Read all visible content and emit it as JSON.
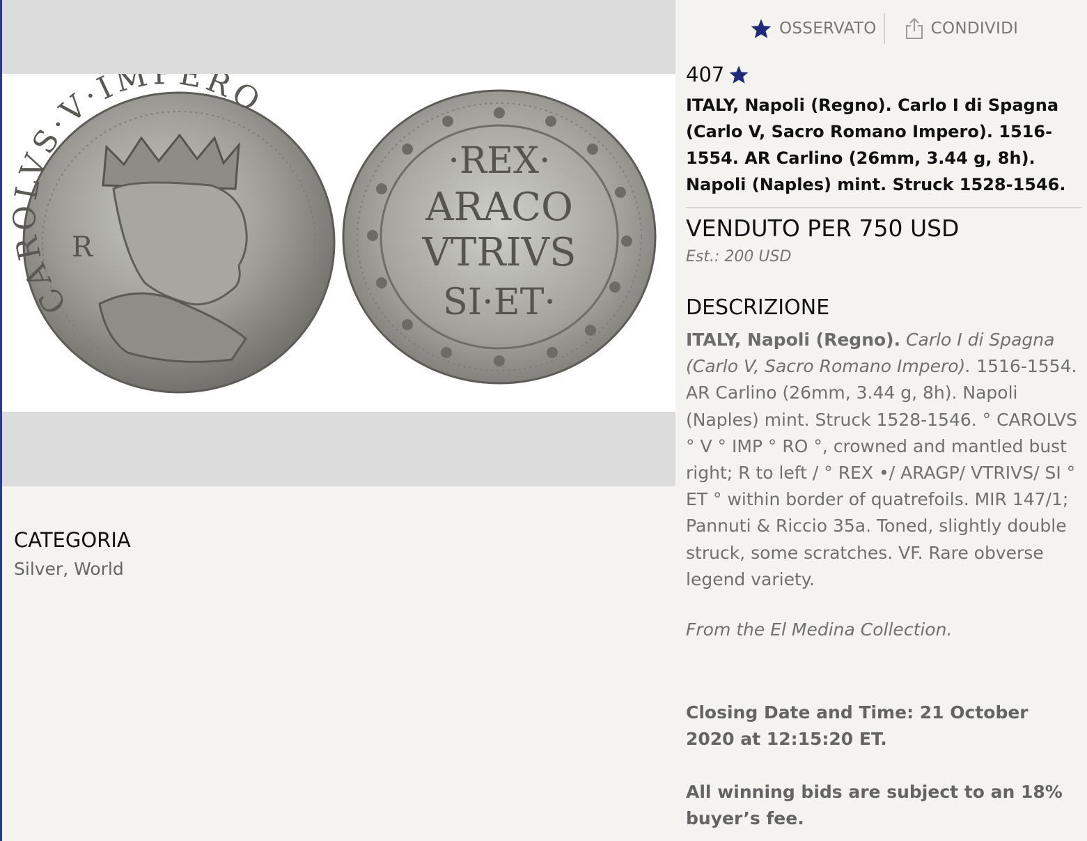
{
  "actions": {
    "watch_label": "OSSERVATO",
    "share_label": "CONDIVIDI"
  },
  "lot": {
    "number": "407",
    "title": "ITALY, Napoli (Regno). Carlo I di Spagna (Carlo V, Sacro Romano Impero). 1516-1554. AR Carlino (26mm, 3.44 g, 8h). Napoli (Naples) mint. Struck 1528-1546."
  },
  "result": {
    "sold": "VENDUTO PER 750 USD",
    "estimate": "Est.: 200 USD"
  },
  "description": {
    "heading": "DESCRIZIONE",
    "lead_bold": "ITALY, Napoli (Regno).",
    "lead_italic": "Carlo I di Spagna (Carlo V, Sacro Romano Impero).",
    "body": "1516-1554. AR Carlino (26mm, 3.44 g, 8h). Napoli (Naples) mint. Struck 1528-1546. ° CAROLVS ° V ° IMP ° RO °, crowned and mantled bust right; R to left / ° REX •/ ARAGP/ VTRIVS/ SI ° ET ° within border of quatrefoils. MIR 147/1; Pannuti & Riccio 35a. Toned, slightly double struck, some scratches. VF. Rare obverse legend variety.",
    "provenance": "From the El Medina Collection.",
    "closing": "Closing Date and Time: 21 October 2020 at 12:15:20 ET.",
    "fee": "All winning bids are subject to an 18% buyer’s fee."
  },
  "category": {
    "heading": "CATEGORIA",
    "value": "Silver, World"
  },
  "coin": {
    "obverse_legend": "CAROLVS·V·IMPERO",
    "obverse_field": "R",
    "reverse_lines": [
      "·REX·",
      "ARACO",
      "VTRIVS",
      "SI·ET·"
    ]
  },
  "colors": {
    "accent_star": "#1e2a78",
    "left_border": "#2e3b84",
    "band": "#dcdcdc"
  }
}
